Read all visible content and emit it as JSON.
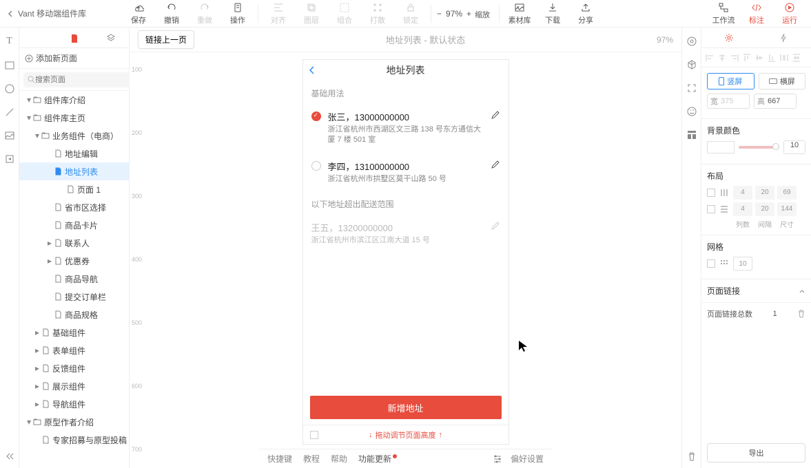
{
  "app_title": "Vant 移动端组件库",
  "toolbar": {
    "save": "保存",
    "undo": "撤销",
    "redo": "重做",
    "operate": "操作",
    "align": "对齐",
    "layer": "图层",
    "group": "组合",
    "scatter": "打散",
    "lock": "锁定",
    "zoom_label": "缩放",
    "zoom_value": "97%",
    "material": "素材库",
    "download": "下载",
    "share": "分享",
    "workflow": "工作流",
    "annotate": "标注",
    "run": "运行"
  },
  "leftpanel": {
    "add_page": "添加新页面",
    "search_placeholder": "搜索页面",
    "tree": [
      {
        "d": 1,
        "t": "folder",
        "open": true,
        "label": "组件库介绍"
      },
      {
        "d": 1,
        "t": "folder",
        "open": true,
        "label": "组件库主页"
      },
      {
        "d": 2,
        "t": "folder",
        "open": true,
        "label": "业务组件（电商）"
      },
      {
        "d": 3,
        "t": "page",
        "label": "地址编辑"
      },
      {
        "d": 3,
        "t": "page",
        "label": "地址列表",
        "active": true
      },
      {
        "d": 4,
        "t": "page",
        "label": "页面 1"
      },
      {
        "d": 3,
        "t": "page",
        "label": "省市区选择"
      },
      {
        "d": 3,
        "t": "page",
        "label": "商品卡片"
      },
      {
        "d": 3,
        "t": "page",
        "hasChildren": true,
        "label": "联系人"
      },
      {
        "d": 3,
        "t": "page",
        "hasChildren": true,
        "label": "优惠券"
      },
      {
        "d": 3,
        "t": "page",
        "label": "商品导航"
      },
      {
        "d": 3,
        "t": "page",
        "label": "提交订单栏"
      },
      {
        "d": 3,
        "t": "page",
        "label": "商品规格"
      },
      {
        "d": 2,
        "t": "page",
        "hasChildren": true,
        "label": "基础组件"
      },
      {
        "d": 2,
        "t": "page",
        "hasChildren": true,
        "label": "表单组件"
      },
      {
        "d": 2,
        "t": "page",
        "hasChildren": true,
        "label": "反馈组件"
      },
      {
        "d": 2,
        "t": "page",
        "hasChildren": true,
        "label": "展示组件"
      },
      {
        "d": 2,
        "t": "page",
        "hasChildren": true,
        "label": "导航组件"
      },
      {
        "d": 1,
        "t": "folder",
        "open": true,
        "label": "原型作者介绍"
      },
      {
        "d": 2,
        "t": "page",
        "label": "专家招募与原型投稿"
      }
    ]
  },
  "canvas": {
    "link_prev": "链接上一页",
    "title": "地址列表 - 默认状态",
    "zoom": "97%",
    "ruler_ticks": [
      "100",
      "200",
      "300",
      "400",
      "500",
      "600",
      "700"
    ],
    "mock": {
      "nav_title": "地址列表",
      "section1_title": "基础用法",
      "addresses": [
        {
          "checked": true,
          "name": "张三，13000000000",
          "detail": "浙江省杭州市西湖区文三路 138 号东方通信大厦 7 楼 501 室",
          "disabled": false
        },
        {
          "checked": false,
          "name": "李四，13100000000",
          "detail": "浙江省杭州市拱墅区莫干山路 50 号",
          "disabled": false
        }
      ],
      "section2_title": "以下地址超出配送范围",
      "addresses_disabled": [
        {
          "name": "王五，13200000000",
          "detail": "浙江省杭州市滨江区江南大道 15 号"
        }
      ],
      "add_btn": "新增地址",
      "resize_hint": "拖动调节页面高度"
    }
  },
  "rightpanel": {
    "orient_portrait": "竖屏",
    "orient_landscape": "横屏",
    "width_label": "宽",
    "width_value": "375",
    "height_label": "高",
    "height_value": "667",
    "bg_title": "背景颜色",
    "bg_opacity": "10",
    "layout_title": "布局",
    "layout_row1": [
      "4",
      "20",
      "69"
    ],
    "layout_row2": [
      "4",
      "20",
      "144"
    ],
    "layout_labels": [
      "列数",
      "间隔",
      "尺寸"
    ],
    "grid_title": "网格",
    "grid_value": "10",
    "link_title": "页面链接",
    "link_count_label": "页面链接总数",
    "link_count": "1",
    "export": "导出"
  },
  "bottombar": {
    "shortcut": "快捷键",
    "tutorial": "教程",
    "help": "帮助",
    "update": "功能更新",
    "pref": "偏好设置"
  }
}
